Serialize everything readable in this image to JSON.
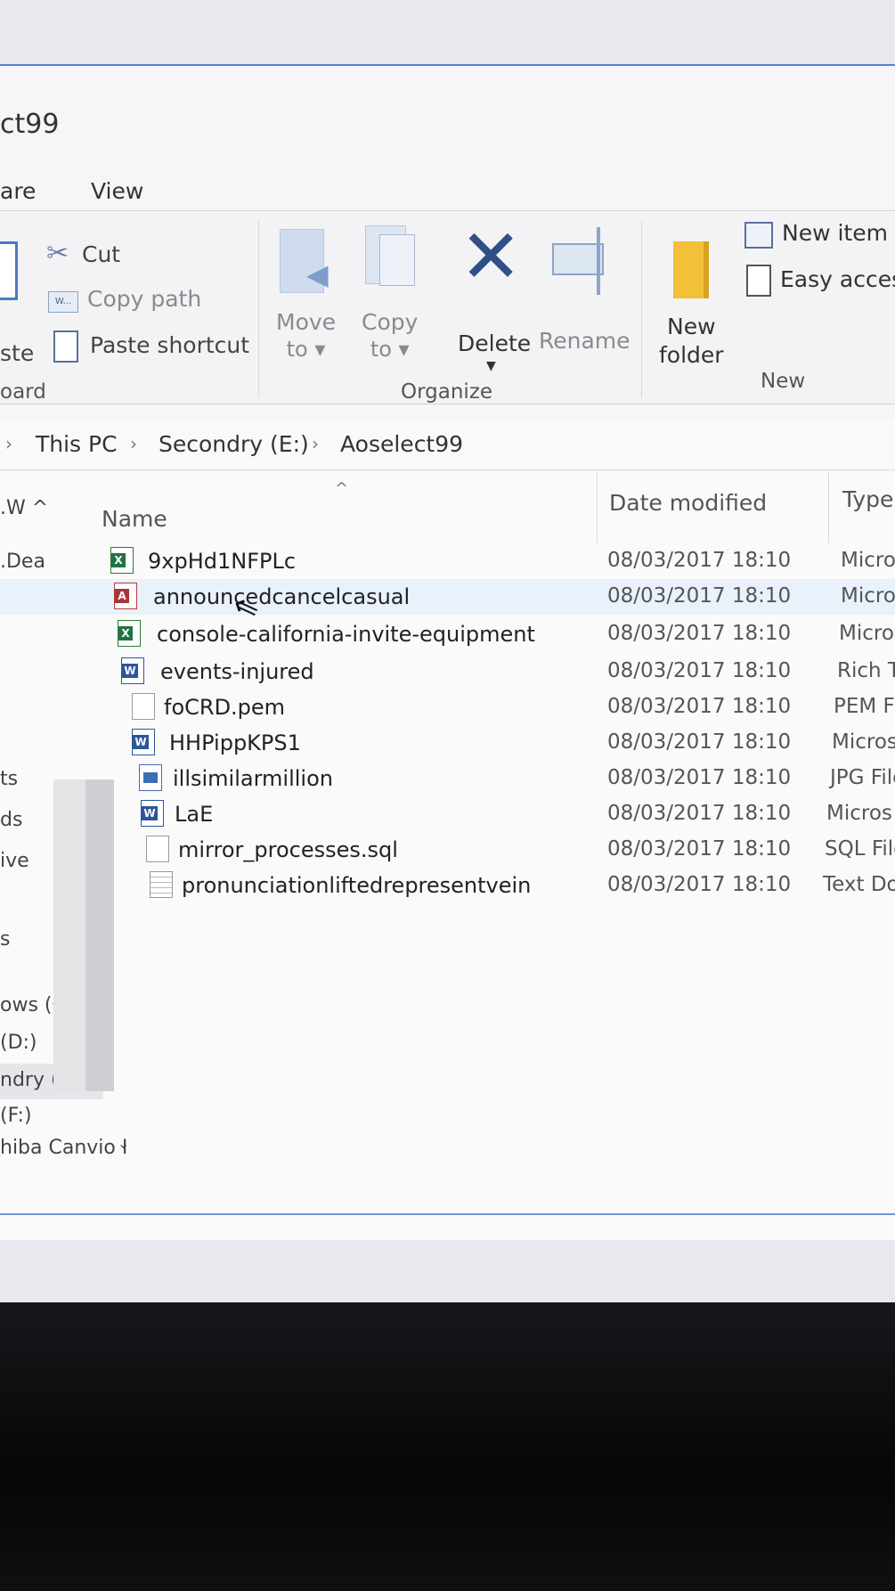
{
  "window": {
    "title": "ct99"
  },
  "menu": {
    "share": "are",
    "view": "View"
  },
  "ribbon": {
    "clipboard": {
      "paste_label": "ste",
      "cut": "Cut",
      "copy_path": "Copy path",
      "paste_shortcut": "Paste shortcut",
      "group_label": "oard"
    },
    "organize": {
      "move_to": [
        "Move",
        "to"
      ],
      "copy_to": [
        "Copy",
        "to"
      ],
      "delete": "Delete",
      "rename": "Rename",
      "group_label": "Organize"
    },
    "new": {
      "new_folder": [
        "New",
        "folder"
      ],
      "new_item": "New item",
      "easy_access": "Easy access",
      "group_label": "New"
    }
  },
  "address": {
    "crumbs": [
      "This PC",
      "Secondry (E:)",
      "Aoselect99"
    ]
  },
  "nav_pane": {
    "header": ".W",
    "items": [
      ".Dea",
      "ts",
      "ds",
      "ive",
      "s",
      "ows (C:)",
      "(D:)",
      "ndry (E:)",
      "(F:)",
      "hiba Canvio I"
    ]
  },
  "columns": {
    "name": "Name",
    "date": "Date modified",
    "type": "Type"
  },
  "files": [
    {
      "name": "9xpHd1NFPLc",
      "date": "08/03/2017 18:10",
      "type": "Micro",
      "icon": "excel-icon"
    },
    {
      "name": "announcedcancelcasual",
      "date": "08/03/2017 18:10",
      "type": "Micro",
      "icon": "access-icon"
    },
    {
      "name": "console-california-invite-equipment",
      "date": "08/03/2017 18:10",
      "type": "Micro",
      "icon": "excel-icon"
    },
    {
      "name": "events-injured",
      "date": "08/03/2017 18:10",
      "type": "Rich T",
      "icon": "word-icon"
    },
    {
      "name": "foCRD.pem",
      "date": "08/03/2017 18:10",
      "type": "PEM F",
      "icon": "blank-file-icon"
    },
    {
      "name": "HHPippKPS1",
      "date": "08/03/2017 18:10",
      "type": "Micros",
      "icon": "word-icon"
    },
    {
      "name": "illsimilarmillion",
      "date": "08/03/2017 18:10",
      "type": "JPG File",
      "icon": "image-icon"
    },
    {
      "name": "LaE",
      "date": "08/03/2017 18:10",
      "type": "Micros",
      "icon": "word-icon"
    },
    {
      "name": "mirror_processes.sql",
      "date": "08/03/2017 18:10",
      "type": "SQL File",
      "icon": "blank-file-icon"
    },
    {
      "name": "pronunciationliftedrepresentvein",
      "date": "08/03/2017 18:10",
      "type": "Text Doc",
      "icon": "text-file-icon"
    }
  ],
  "colors": {
    "accent": "#5a7fd0",
    "hover_row": "#e9f1fb",
    "delete_x": "#2f4f86"
  }
}
